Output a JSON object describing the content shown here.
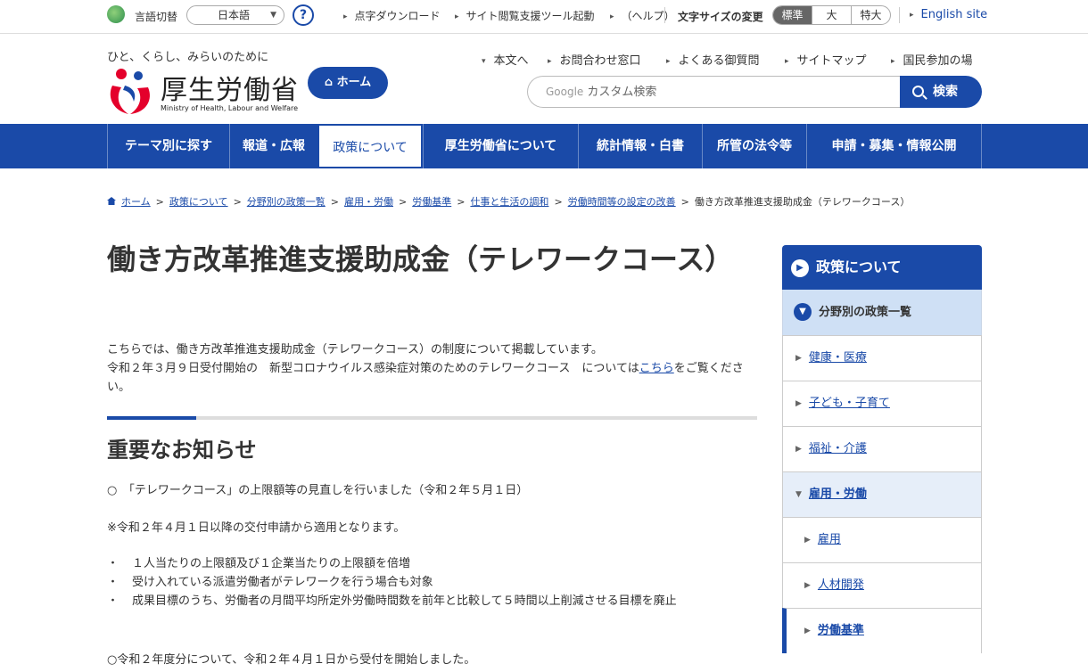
{
  "topbar": {
    "lang_label": "言語切替",
    "lang_value": "日本語",
    "help_glyph": "?",
    "links": [
      "点字ダウンロード",
      "サイト閲覧支援ツール起動",
      "（ヘルプ）"
    ],
    "font_size_label": "文字サイズの変更",
    "font_sizes": [
      "標準",
      "大",
      "特大"
    ],
    "english": "English site"
  },
  "header": {
    "tagline": "ひと、くらし、みらいのために",
    "logo_text": "厚生労働省",
    "logo_sub": "Ministry of Health, Labour and Welfare",
    "home": "ホーム",
    "links": [
      "本文へ",
      "お問合わせ窓口",
      "よくある御質問",
      "サイトマップ",
      "国民参加の場"
    ],
    "search_brand": "Google",
    "search_placeholder": "カスタム検索",
    "search_button": "検索"
  },
  "gnav": [
    "テーマ別に探す",
    "報道・広報",
    "政策について",
    "厚生労働省について",
    "統計情報・白書",
    "所管の法令等",
    "申請・募集・情報公開"
  ],
  "breadcrumb": [
    "ホーム",
    "政策について",
    "分野別の政策一覧",
    "雇用・労働",
    "労働基準",
    "仕事と生活の調和",
    "労働時間等の設定の改善",
    "働き方改革推進支援助成金（テレワークコース）"
  ],
  "main": {
    "title": "働き方改革推進支援助成金（テレワークコース）",
    "intro1": "こちらでは、働き方改革推進支援助成金（テレワークコース）の制度について掲載しています。",
    "intro2a": "令和２年３月９日受付開始の　新型コロナウイルス感染症対策のためのテレワークコース　については",
    "intro2_link": "こちら",
    "intro2b": "をご覧ください。",
    "h2": "重要なお知らせ",
    "notice1": "○　「テレワークコース」の上限額等の見直しを行いました（令和２年５月１日）",
    "notice2": "※令和２年４月１日以降の交付申請から適用となります。",
    "bullets": [
      "１人当たりの上限額及び１企業当たりの上限額を倍増",
      "受け入れている派遣労働者がテレワークを行う場合も対象",
      "成果目標のうち、労働者の月間平均所定外労働時間数を前年と比較して５時間以上削減させる目標を廃止"
    ],
    "notice3": "○令和２年度分について、令和２年４月１日から受付を開始しました。"
  },
  "side": {
    "head": "政策について",
    "sub": "分野別の政策一覧",
    "items": [
      "健康・医療",
      "子ども・子育て",
      "福祉・介護",
      "雇用・労働"
    ],
    "children": [
      "雇用",
      "人材開発",
      "労働基準"
    ]
  },
  "colors": {
    "brand": "#1a4aa8",
    "sub_bg": "#cfe0f5"
  }
}
